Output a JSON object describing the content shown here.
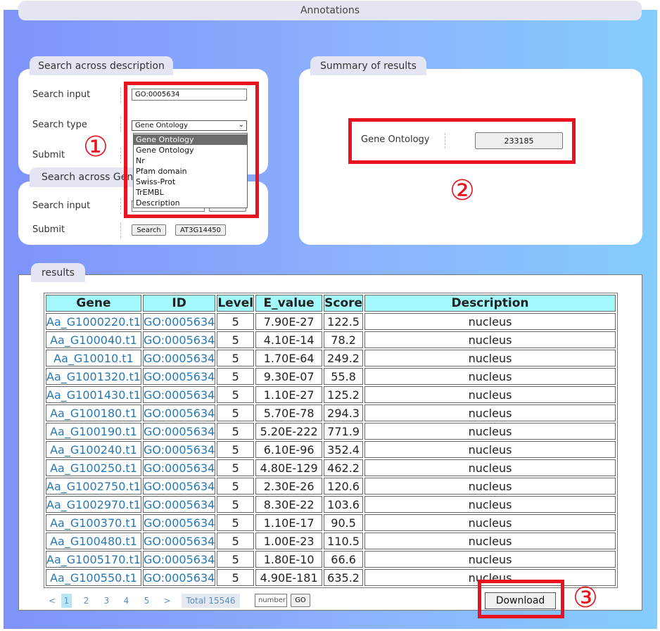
{
  "header": {
    "title": "Annotations"
  },
  "search_description": {
    "tab_label": "Search across description",
    "search_input_label": "Search input",
    "search_input_value": "GO:0005634",
    "search_type_label": "Search type",
    "search_type_value": "Gene Ontology",
    "submit_label": "Submit",
    "dropdown_options": [
      "Gene Ontology",
      "Gene Ontology",
      "Nr",
      "Pfam domain",
      "Swiss-Prot",
      "TrEMBL",
      "Description"
    ],
    "caret": "⌄"
  },
  "search_gene": {
    "tab_label": "Search across Gene",
    "search_input_label": "Search input",
    "submit_label": "Submit",
    "search_button": "Search",
    "example_button": "AT3G14450"
  },
  "summary": {
    "tab_label": "Summary of results",
    "label": "Gene Ontology",
    "count": "233185"
  },
  "results": {
    "tab_label": "results",
    "columns": [
      "Gene",
      "ID",
      "Level",
      "E_value",
      "Score",
      "Description"
    ],
    "rows": [
      {
        "gene": "Aa_G1000220.t1",
        "id": "GO:0005634",
        "level": "5",
        "evalue": "7.90E-27",
        "score": "122.5",
        "desc": "nucleus"
      },
      {
        "gene": "Aa_G100040.t1",
        "id": "GO:0005634",
        "level": "5",
        "evalue": "4.10E-14",
        "score": "78.2",
        "desc": "nucleus"
      },
      {
        "gene": "Aa_G10010.t1",
        "id": "GO:0005634",
        "level": "5",
        "evalue": "1.70E-64",
        "score": "249.2",
        "desc": "nucleus"
      },
      {
        "gene": "Aa_G1001320.t1",
        "id": "GO:0005634",
        "level": "5",
        "evalue": "9.30E-07",
        "score": "55.8",
        "desc": "nucleus"
      },
      {
        "gene": "Aa_G1001430.t1",
        "id": "GO:0005634",
        "level": "5",
        "evalue": "1.10E-27",
        "score": "125.2",
        "desc": "nucleus"
      },
      {
        "gene": "Aa_G100180.t1",
        "id": "GO:0005634",
        "level": "5",
        "evalue": "5.70E-78",
        "score": "294.3",
        "desc": "nucleus"
      },
      {
        "gene": "Aa_G100190.t1",
        "id": "GO:0005634",
        "level": "5",
        "evalue": "5.20E-222",
        "score": "771.9",
        "desc": "nucleus"
      },
      {
        "gene": "Aa_G100240.t1",
        "id": "GO:0005634",
        "level": "5",
        "evalue": "6.10E-96",
        "score": "352.4",
        "desc": "nucleus"
      },
      {
        "gene": "Aa_G100250.t1",
        "id": "GO:0005634",
        "level": "5",
        "evalue": "4.80E-129",
        "score": "462.2",
        "desc": "nucleus"
      },
      {
        "gene": "Aa_G1002750.t1",
        "id": "GO:0005634",
        "level": "5",
        "evalue": "2.30E-26",
        "score": "120.6",
        "desc": "nucleus"
      },
      {
        "gene": "Aa_G1002970.t1",
        "id": "GO:0005634",
        "level": "5",
        "evalue": "8.30E-22",
        "score": "103.6",
        "desc": "nucleus"
      },
      {
        "gene": "Aa_G100370.t1",
        "id": "GO:0005634",
        "level": "5",
        "evalue": "1.10E-17",
        "score": "90.5",
        "desc": "nucleus"
      },
      {
        "gene": "Aa_G100480.t1",
        "id": "GO:0005634",
        "level": "5",
        "evalue": "1.00E-23",
        "score": "110.5",
        "desc": "nucleus"
      },
      {
        "gene": "Aa_G1005170.t1",
        "id": "GO:0005634",
        "level": "5",
        "evalue": "1.80E-10",
        "score": "66.6",
        "desc": "nucleus"
      },
      {
        "gene": "Aa_G100550.t1",
        "id": "GO:0005634",
        "level": "5",
        "evalue": "4.90E-181",
        "score": "635.2",
        "desc": "nucleus"
      }
    ]
  },
  "pagination": {
    "prev": "<",
    "pages": [
      "1",
      "2",
      "3",
      "4",
      "5"
    ],
    "next": ">",
    "total": "Total 15546",
    "number_placeholder": "number",
    "go": "GO",
    "download": "Download"
  },
  "markers": [
    "①",
    "②",
    "③"
  ],
  "colors": {
    "highlight_red": "#e8131f",
    "table_header": "#a3f8fb",
    "link": "#2877b4"
  }
}
